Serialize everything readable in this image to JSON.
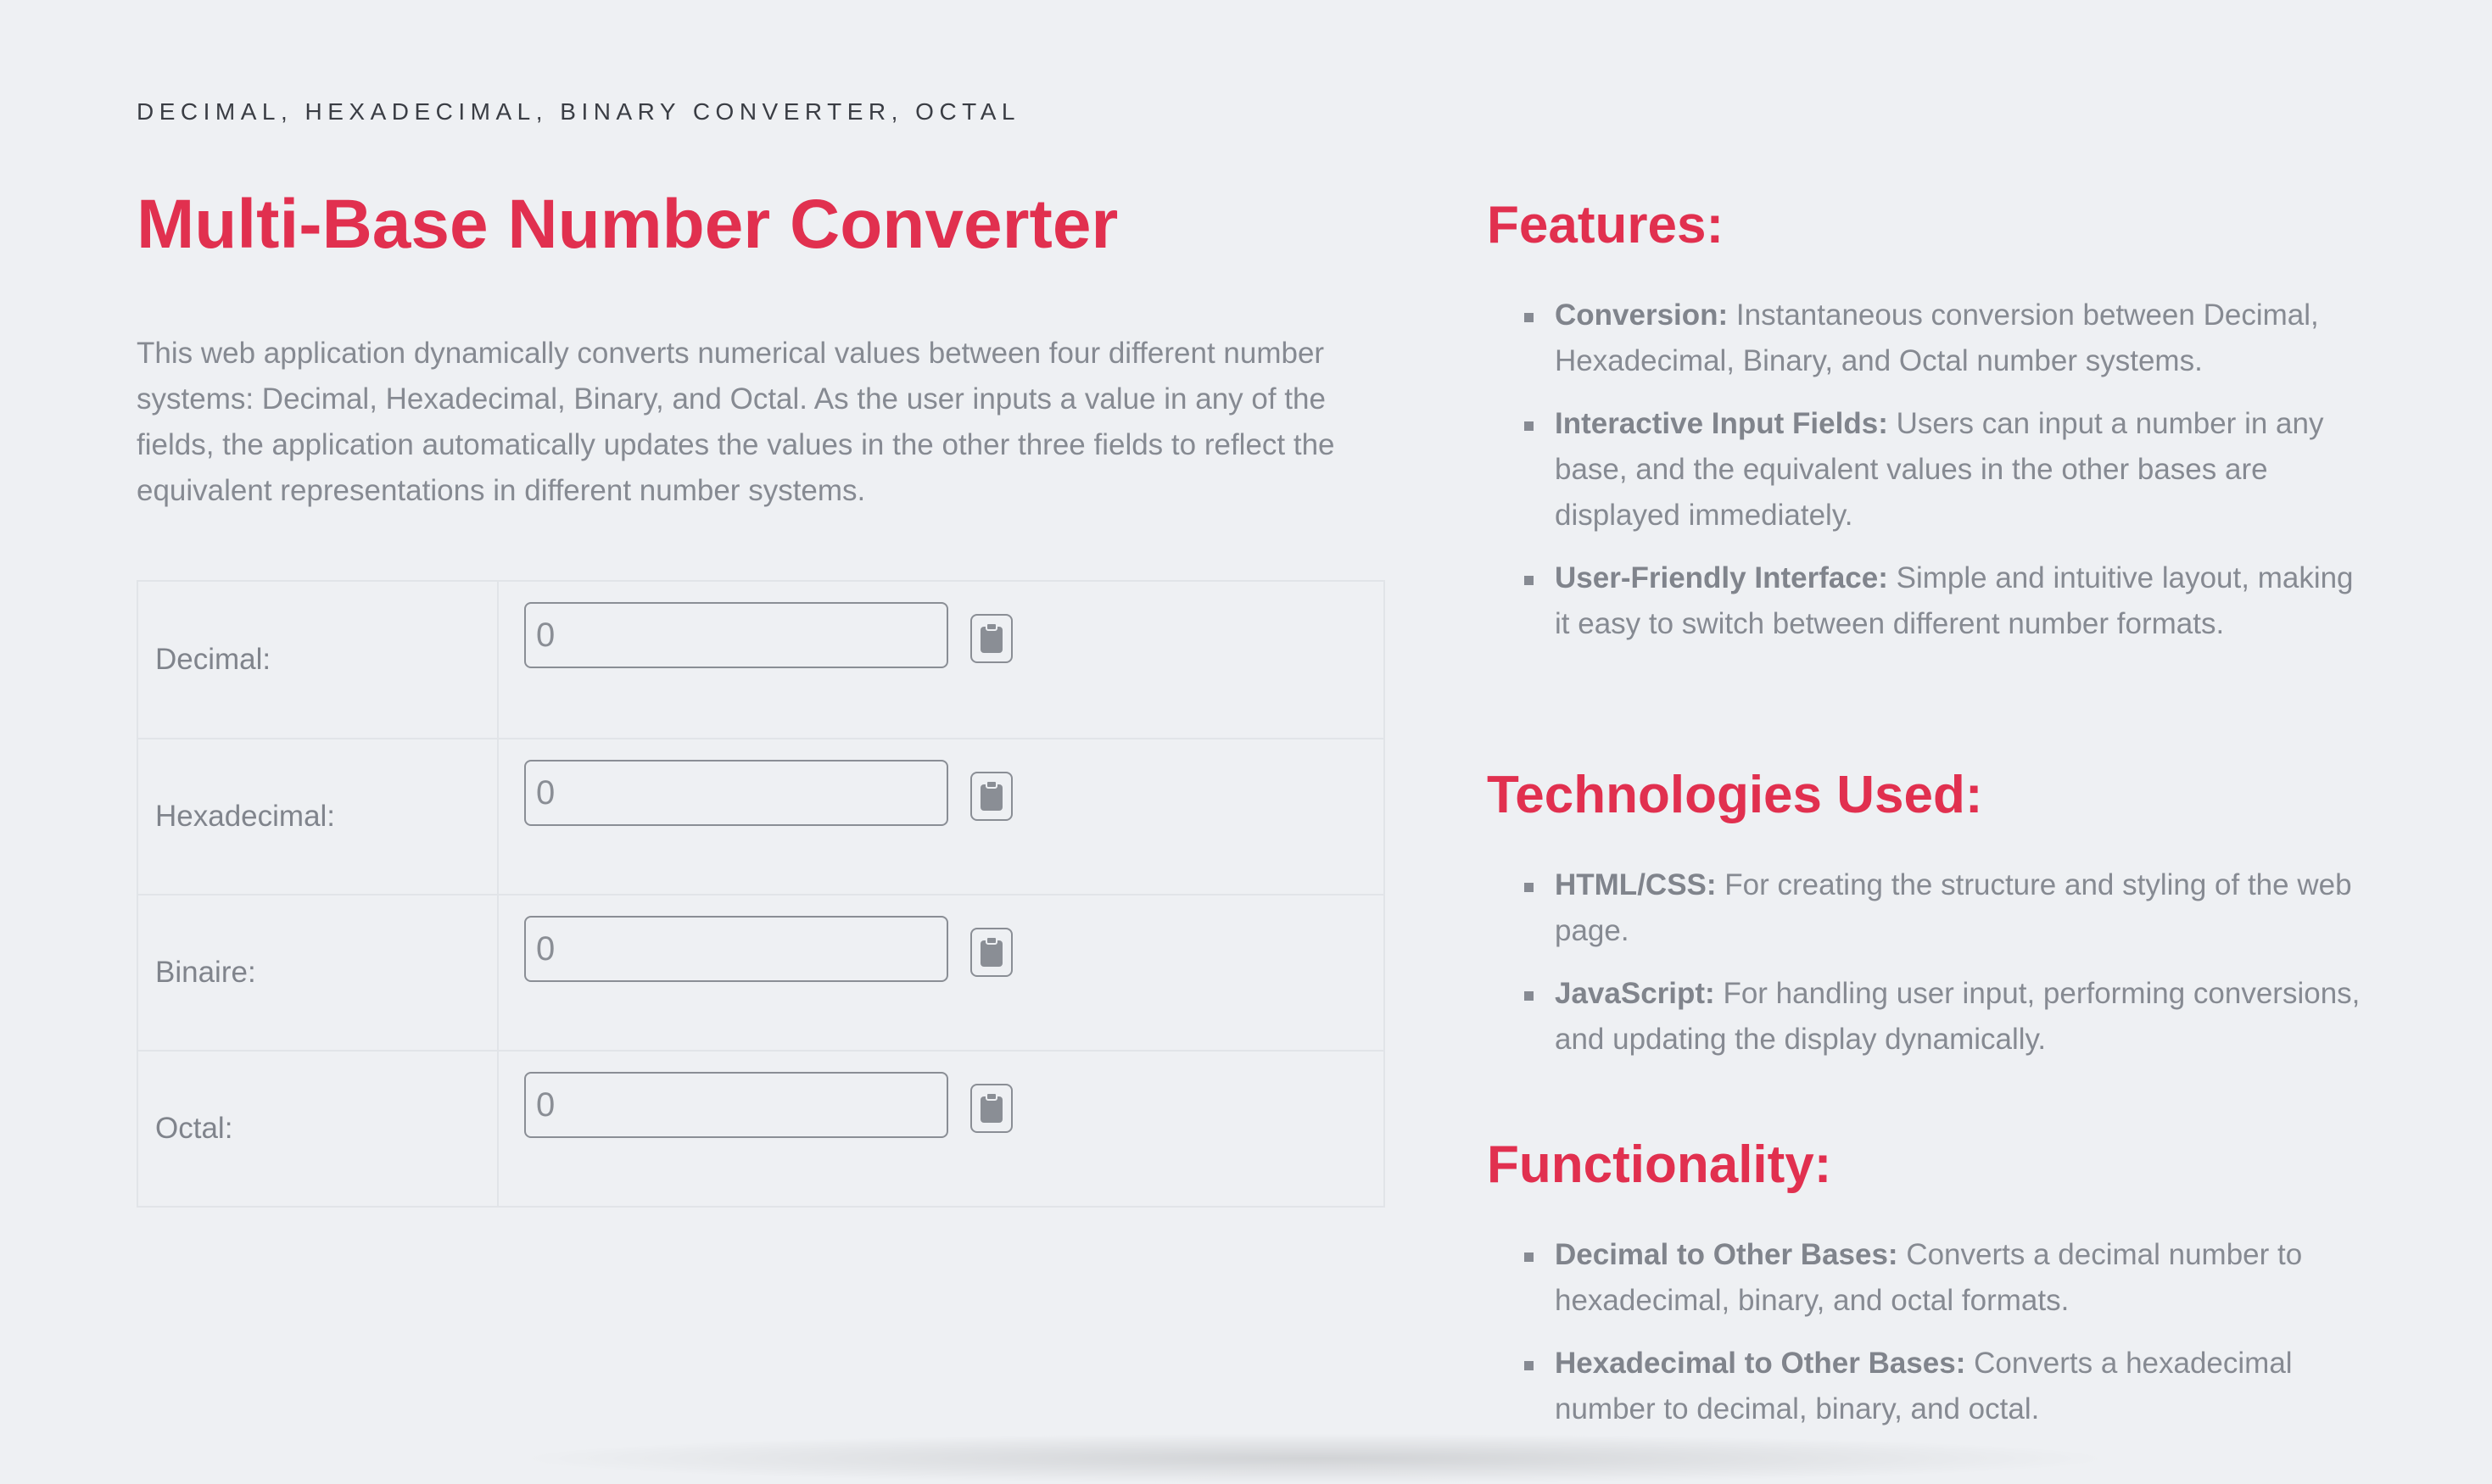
{
  "header": {
    "eyebrow": "DECIMAL, HEXADECIMAL, BINARY CONVERTER, OCTAL",
    "title": "Multi-Base Number Converter",
    "intro": "This web application dynamically converts numerical values between four different number systems: Decimal, Hexadecimal, Binary, and Octal. As the user inputs a value in any of the fields, the application automatically updates the values in the other three fields to reflect the equivalent representations in different number systems."
  },
  "converter": {
    "rows": [
      {
        "label": "Decimal:",
        "value": "0",
        "copy_icon": "clipboard-icon"
      },
      {
        "label": "Hexadecimal:",
        "value": "0",
        "copy_icon": "clipboard-icon"
      },
      {
        "label": "Binaire:",
        "value": "0",
        "copy_icon": "clipboard-icon"
      },
      {
        "label": "Octal:",
        "value": "0",
        "copy_icon": "clipboard-icon"
      }
    ]
  },
  "sections": {
    "features": {
      "heading": "Features:",
      "items": [
        {
          "term": "Conversion:",
          "text": " Instantaneous conversion between Decimal, Hexadecimal, Binary, and Octal number systems."
        },
        {
          "term": "Interactive Input Fields:",
          "text": " Users can input a number in any base, and the equivalent values in the other bases are displayed immediately."
        },
        {
          "term": "User-Friendly Interface:",
          "text": " Simple and intuitive layout, making it easy to switch between different number formats."
        }
      ]
    },
    "technologies": {
      "heading": "Technologies Used:",
      "items": [
        {
          "term": "HTML/CSS:",
          "text": " For creating the structure and styling of the web page."
        },
        {
          "term": "JavaScript:",
          "text": " For handling user input, performing conversions, and updating the display dynamically."
        }
      ]
    },
    "functionality": {
      "heading": "Functionality:",
      "items": [
        {
          "term": "Decimal to Other Bases:",
          "text": " Converts a decimal number to hexadecimal, binary, and octal formats."
        },
        {
          "term": "Hexadecimal to Other Bases:",
          "text": " Converts a hexadecimal number to decimal, binary, and octal."
        }
      ]
    }
  },
  "colors": {
    "accent": "#e1304f",
    "background": "#eef0f3",
    "text": "#868a92"
  }
}
